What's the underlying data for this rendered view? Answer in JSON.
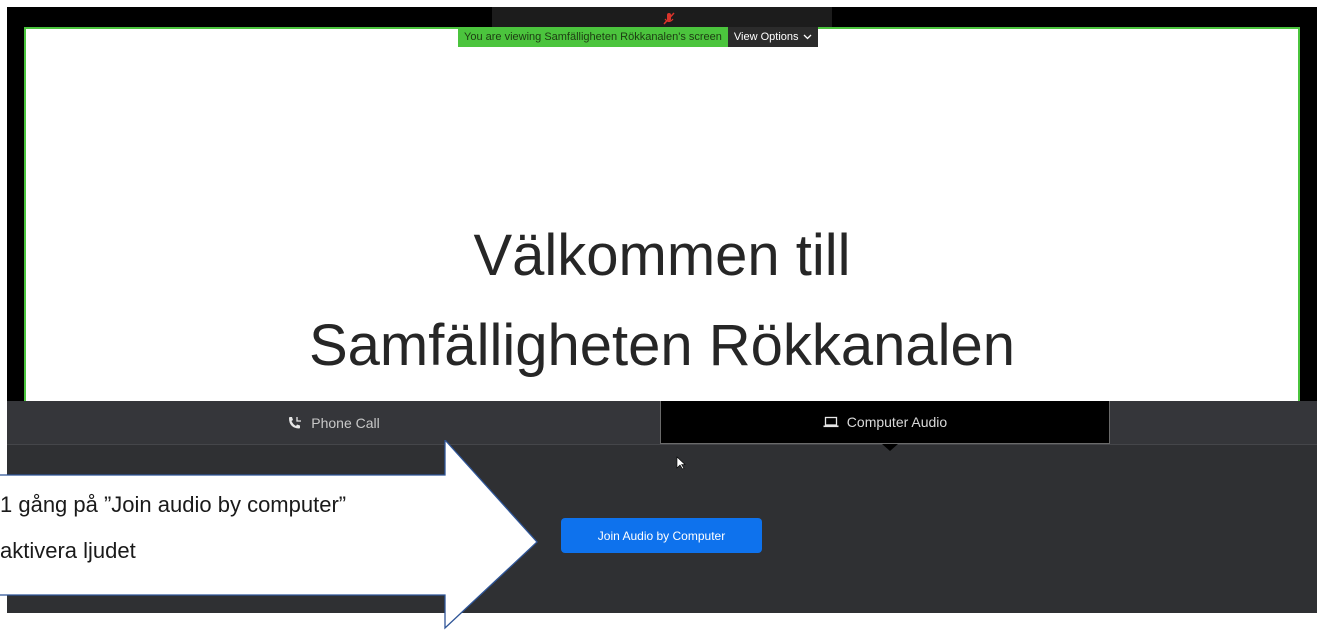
{
  "banner": {
    "viewing_text": "You are viewing Samfälligheten Rökkanalen's screen",
    "view_options_label": "View Options"
  },
  "slide": {
    "line1": "Välkommen till",
    "line2": "Samfälligheten Rökkanalen"
  },
  "audio_tabs": [
    {
      "label": "Phone Call",
      "icon": "phone-icon"
    },
    {
      "label": "Computer Audio",
      "icon": "laptop-icon"
    }
  ],
  "join_button": {
    "label": "Join Audio by Computer"
  },
  "callout": {
    "line1": "1 gång på ”Join audio by computer”",
    "line2": "aktivera ljudet"
  },
  "colors": {
    "accent_green": "#4bc43d",
    "join_blue": "#0e72ed",
    "panel_dark": "#2f3033"
  }
}
